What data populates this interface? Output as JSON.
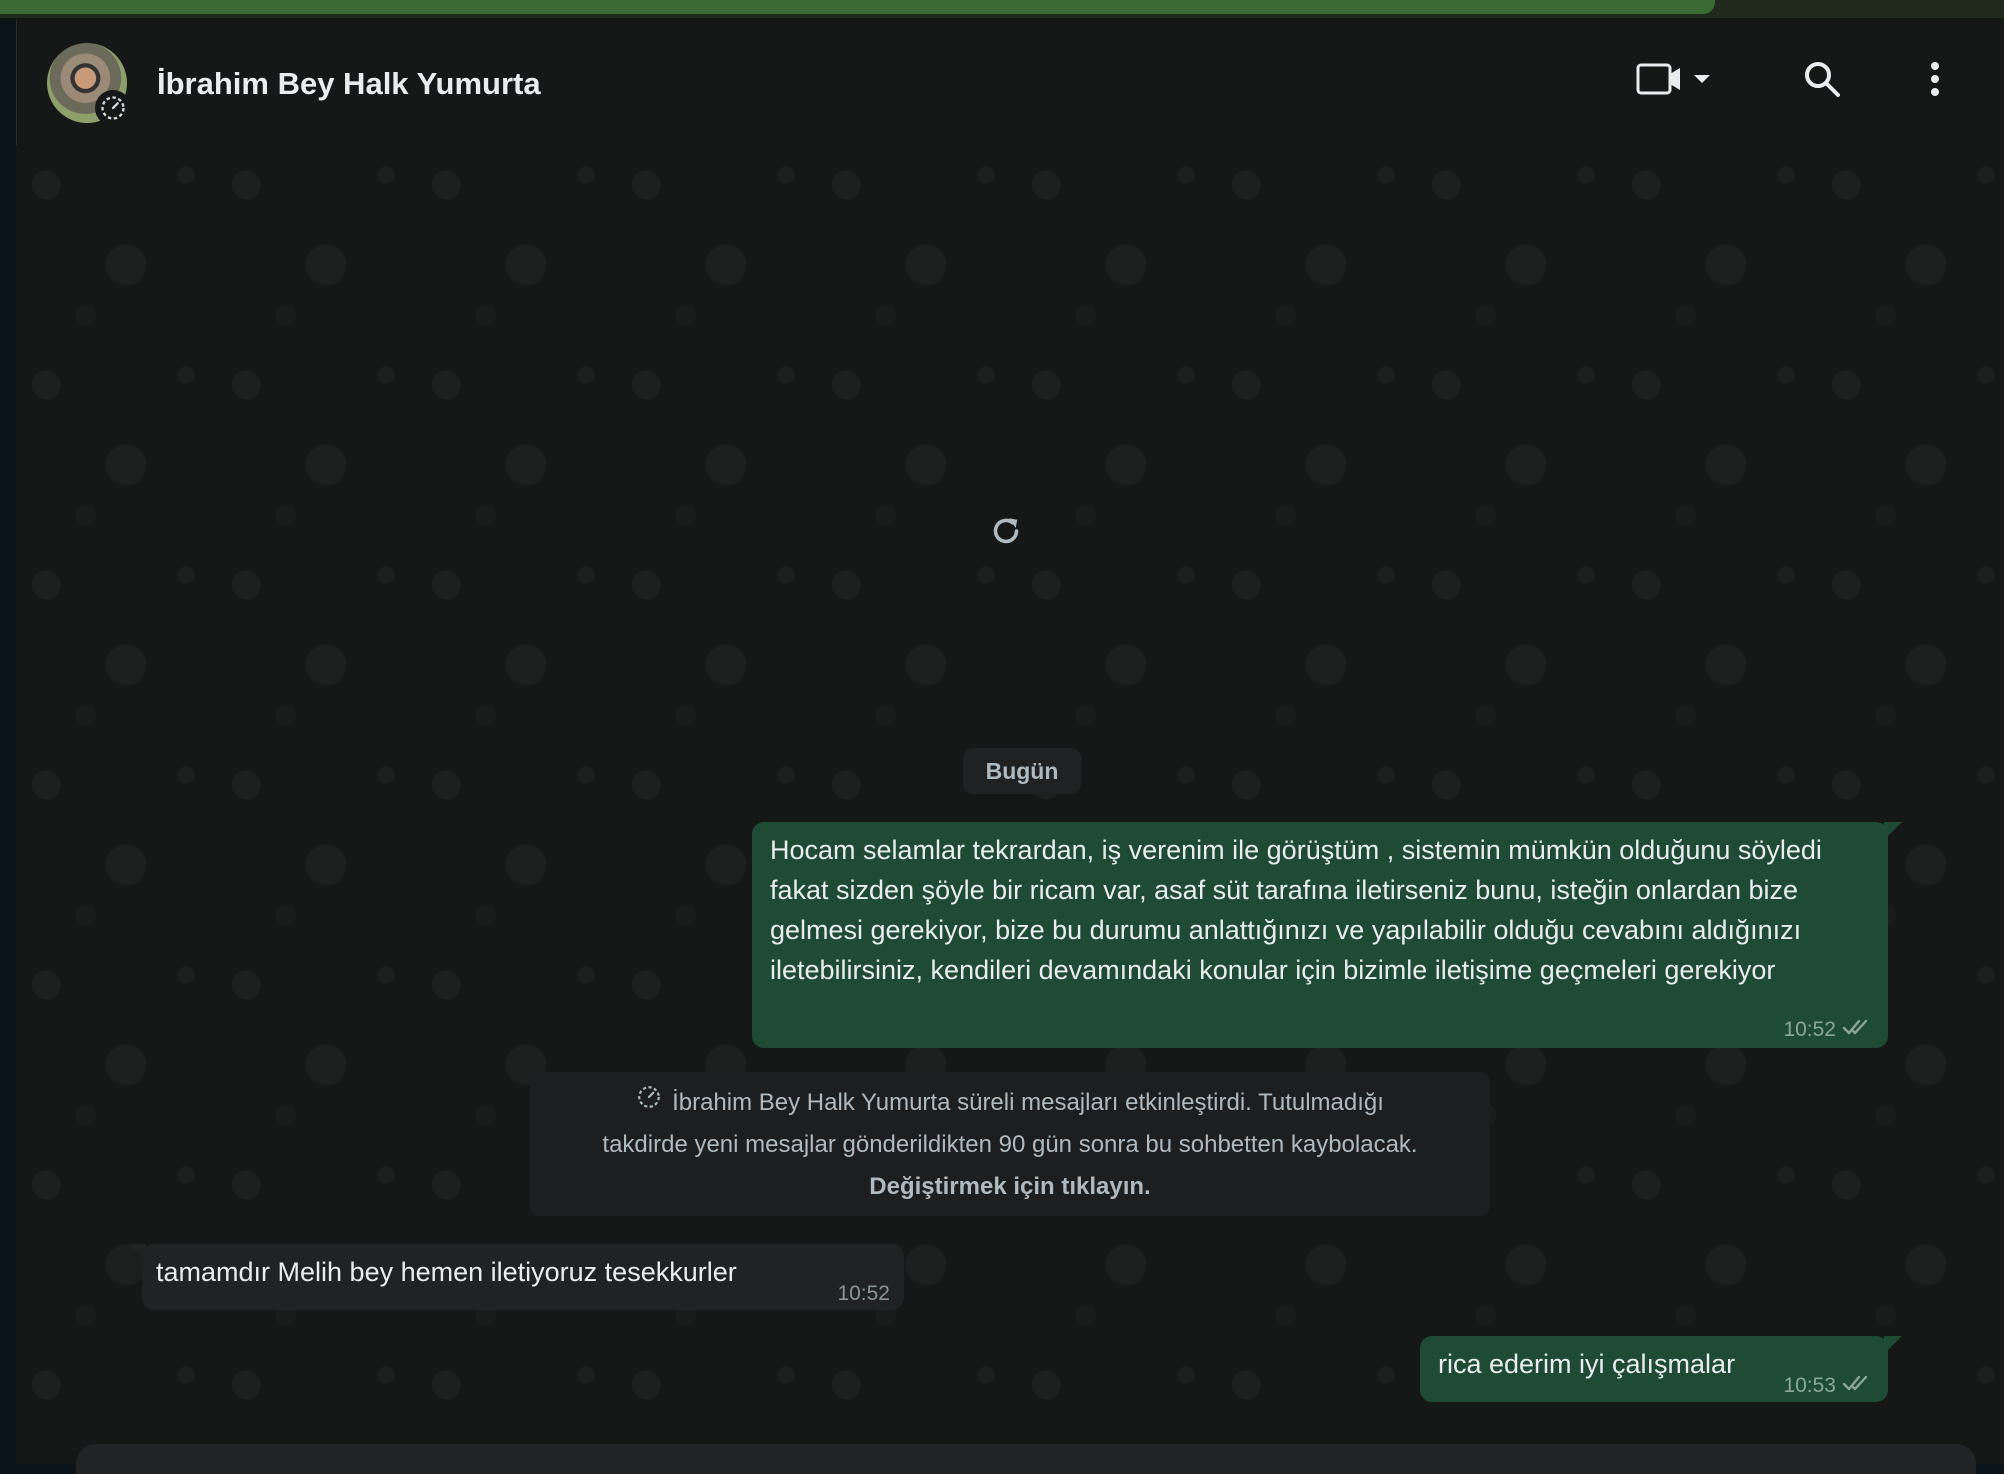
{
  "header": {
    "contact_name": "İbrahim Bey Halk Yumurta"
  },
  "chat": {
    "date_separator": "Bugün",
    "messages": [
      {
        "direction": "out",
        "text": "Hocam selamlar tekrardan, iş verenim ile görüştüm , sistemin mümkün olduğunu söyledi fakat sizden şöyle bir ricam var, asaf süt tarafına iletirseniz bunu, isteğin onlardan bize gelmesi gerekiyor, bize bu durumu anlattığınızı ve yapılabilir olduğu cevabını aldığınızı iletebilirsiniz, kendileri devamındaki konular için bizimle iletişime geçmeleri gerekiyor",
        "time": "10:52",
        "status": "read"
      },
      {
        "direction": "in",
        "text": "tamamdır Melih bey hemen iletiyoruz tesekkurler",
        "time": "10:52"
      },
      {
        "direction": "out",
        "text": "rica ederim iyi çalışmalar",
        "time": "10:53",
        "status": "read"
      }
    ],
    "system_message": {
      "line1": "İbrahim Bey Halk Yumurta süreli mesajları etkinleştirdi. Tutulmadığı",
      "line2": "takdirde yeni mesajlar gönderildikten 90 gün sonra bu sohbetten kaybolacak.",
      "action": "Değiştirmek için tıklayın."
    }
  },
  "icons": {
    "video": "video-call-icon",
    "dropdown": "chevron-down-icon",
    "search": "search-icon",
    "menu": "more-vertical-icon",
    "timer": "disappearing-timer-icon",
    "refresh": "refresh-icon",
    "ticks": "double-check-icon"
  },
  "colors": {
    "accent_green": "#3b6b33",
    "outgoing_bubble": "#1f4a34",
    "incoming_bubble": "#202223",
    "background": "#161717"
  }
}
